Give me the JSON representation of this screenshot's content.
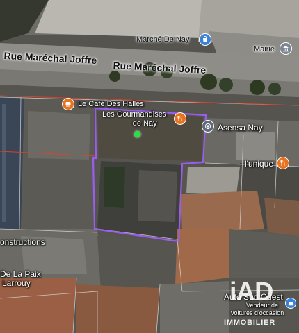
{
  "streets": {
    "left": "Rue Maréchal Joffre",
    "right": "Rue Maréchal Joffre"
  },
  "pois": {
    "marche": "Marché De Nay",
    "mairie": "Mairie",
    "cafe": "Le Café Des Halles",
    "gourmandises_line1": "Les Gourmandises",
    "gourmandises_line2": "de Nay",
    "asensa": "Asensa Nay",
    "unique": "l'unique",
    "constructions": "onstructions",
    "paix_line1": "De La Paix",
    "paix_line2": "Larrouy",
    "auto_line1": "Auto Sud Ouest",
    "auto_line2": "Vendeur de",
    "auto_line3": "voitures d'occasion"
  },
  "logo": {
    "mark": "iAD",
    "sub": "IMMOBILIER"
  },
  "colors": {
    "parcel_outline": "#9b5cf0",
    "food_pin": "#e8731f",
    "shop_pin": "#3b82d6",
    "location_dot": "#1ee63f"
  },
  "icons": {
    "food": "fork-knife-icon",
    "shop": "shopping-bag-icon",
    "gov": "building-icon",
    "place": "target-icon"
  }
}
